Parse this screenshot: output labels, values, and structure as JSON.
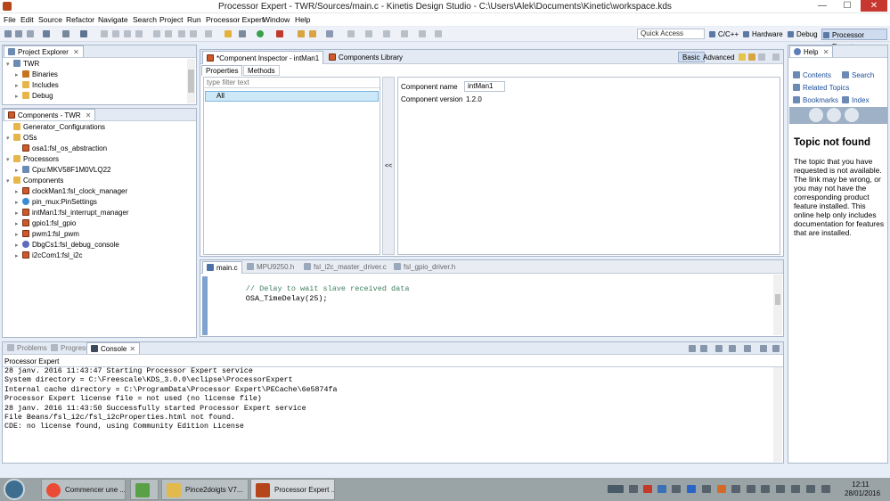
{
  "window": {
    "title": "Processor Expert - TWR/Sources/main.c - Kinetis Design Studio - C:\\Users\\Alek\\Documents\\Kinetic\\workspace.kds",
    "minimize": "—",
    "maximize": "☐",
    "close": "✕"
  },
  "menu": [
    "File",
    "Edit",
    "Source",
    "Refactor",
    "Navigate",
    "Search",
    "Project",
    "Run",
    "Processor Expert",
    "Window",
    "Help"
  ],
  "quick_access": {
    "placeholder": "Quick Access"
  },
  "perspectives": [
    "C/C++",
    "Hardware",
    "Debug",
    "Processor Expert"
  ],
  "project_explorer": {
    "tab": "Project Explorer",
    "close": "✕",
    "root": "TWR",
    "children": [
      "Binaries",
      "Includes",
      "Debug"
    ]
  },
  "components": {
    "tab": "Components - TWR",
    "close": "✕",
    "tree": [
      {
        "label": "Generator_Configurations",
        "level": 0,
        "icon": "folder",
        "arrow": ""
      },
      {
        "label": "OSs",
        "level": 0,
        "icon": "folder",
        "arrow": "▾"
      },
      {
        "label": "osa1:fsl_os_abstraction",
        "level": 1,
        "icon": "comp",
        "arrow": ""
      },
      {
        "label": "Processors",
        "level": 0,
        "icon": "folder",
        "arrow": "▾"
      },
      {
        "label": "Cpu:MKV58F1M0VLQ22",
        "level": 1,
        "icon": "proj",
        "arrow": "▸"
      },
      {
        "label": "Components",
        "level": 0,
        "icon": "folder",
        "arrow": "▾"
      },
      {
        "label": "clockMan1:fsl_clock_manager",
        "level": 1,
        "icon": "comp",
        "arrow": "▸"
      },
      {
        "label": "pin_mux:PinSettings",
        "level": 1,
        "icon": "pin",
        "arrow": "▸"
      },
      {
        "label": "intMan1:fsl_interrupt_manager",
        "level": 1,
        "icon": "comp",
        "arrow": "▸"
      },
      {
        "label": "gpio1:fsl_gpio",
        "level": 1,
        "icon": "comp",
        "arrow": "▸"
      },
      {
        "label": "pwm1:fsl_pwm",
        "level": 1,
        "icon": "comp",
        "arrow": "▸"
      },
      {
        "label": "DbgCs1:fsl_debug_console",
        "level": 1,
        "icon": "dbg",
        "arrow": "▸"
      },
      {
        "label": "i2cCom1:fsl_i2c",
        "level": 1,
        "icon": "comp",
        "arrow": "▸"
      }
    ]
  },
  "inspector": {
    "tab": "*Component Inspector - intMan1",
    "tab2": "Components Library",
    "modes": [
      "Basic",
      "Advanced"
    ],
    "subtabs": [
      "Properties",
      "Methods"
    ],
    "filter_placeholder": "type filter text",
    "filter_item": "All",
    "collapse": "<<",
    "component_name_label": "Component name",
    "component_name_value": "intMan1",
    "component_version_label": "Component version",
    "component_version_value": "1.2.0"
  },
  "editor": {
    "tabs": [
      "main.c",
      "MPU9250.h",
      "fsl_i2c_master_driver.c",
      "fsl_gpio_driver.h"
    ],
    "lines": [
      "        // Delay to wait slave received data",
      "        OSA_TimeDelay(25);"
    ]
  },
  "help": {
    "tab": "Help",
    "close": "✕",
    "links": [
      "Contents",
      "Search",
      "Related Topics",
      "Bookmarks",
      "Index"
    ],
    "heading": "Topic not found",
    "body": "The topic that you have requested is not available. The link may be wrong, or you may not have the corresponding product feature installed. This online help only includes documentation for features that are installed."
  },
  "console": {
    "tabs": [
      "Problems",
      "Progress",
      "Console"
    ],
    "header": "Processor Expert",
    "lines": [
      "28 janv. 2016 11:43:47 Starting Processor Expert service",
      "System directory = C:\\Freescale\\KDS_3.0.0\\eclipse\\ProcessorExpert",
      "Internal cache directory = C:\\ProgramData\\Processor Expert\\PECache\\6e5874fa",
      "Processor Expert license file = not used (no license file)",
      "28 janv. 2016 11:43:50 Successfully started Processor Expert service",
      "File Beans/fsl_i2c/fsl_i2cProperties.html not found.",
      "CDE: no license found, using Community Edition License"
    ]
  },
  "taskbar": {
    "tasks": [
      "Commencer une ...",
      "",
      "Pince2doigts V7...",
      "Processor Expert ..."
    ],
    "time": "12:11",
    "date": "28/01/2016"
  }
}
